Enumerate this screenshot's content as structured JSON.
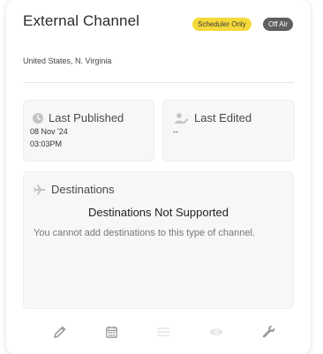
{
  "channel": {
    "name": "External Channel",
    "badges": {
      "scheduler": "Scheduler Only",
      "status": "Off Air"
    },
    "region": "United States, N. Virginia"
  },
  "last_published": {
    "label": "Last Published",
    "date": "08 Nov '24",
    "time": "03:03PM"
  },
  "last_edited": {
    "label": "Last Edited",
    "value": "--"
  },
  "destinations": {
    "label": "Destinations",
    "heading": "Destinations Not Supported",
    "message": "You cannot add destinations to this type of channel."
  },
  "toolbar": {
    "icons": [
      "pencil-icon",
      "calendar-icon",
      "list-icon",
      "eye-icon",
      "wrench-icon"
    ]
  },
  "colors": {
    "scheduler_badge": "#f5d93a",
    "off_air_badge": "#5f5f5f",
    "icon_gray": "#9a9a9a",
    "disabled_icon": "#e6e6e6"
  }
}
